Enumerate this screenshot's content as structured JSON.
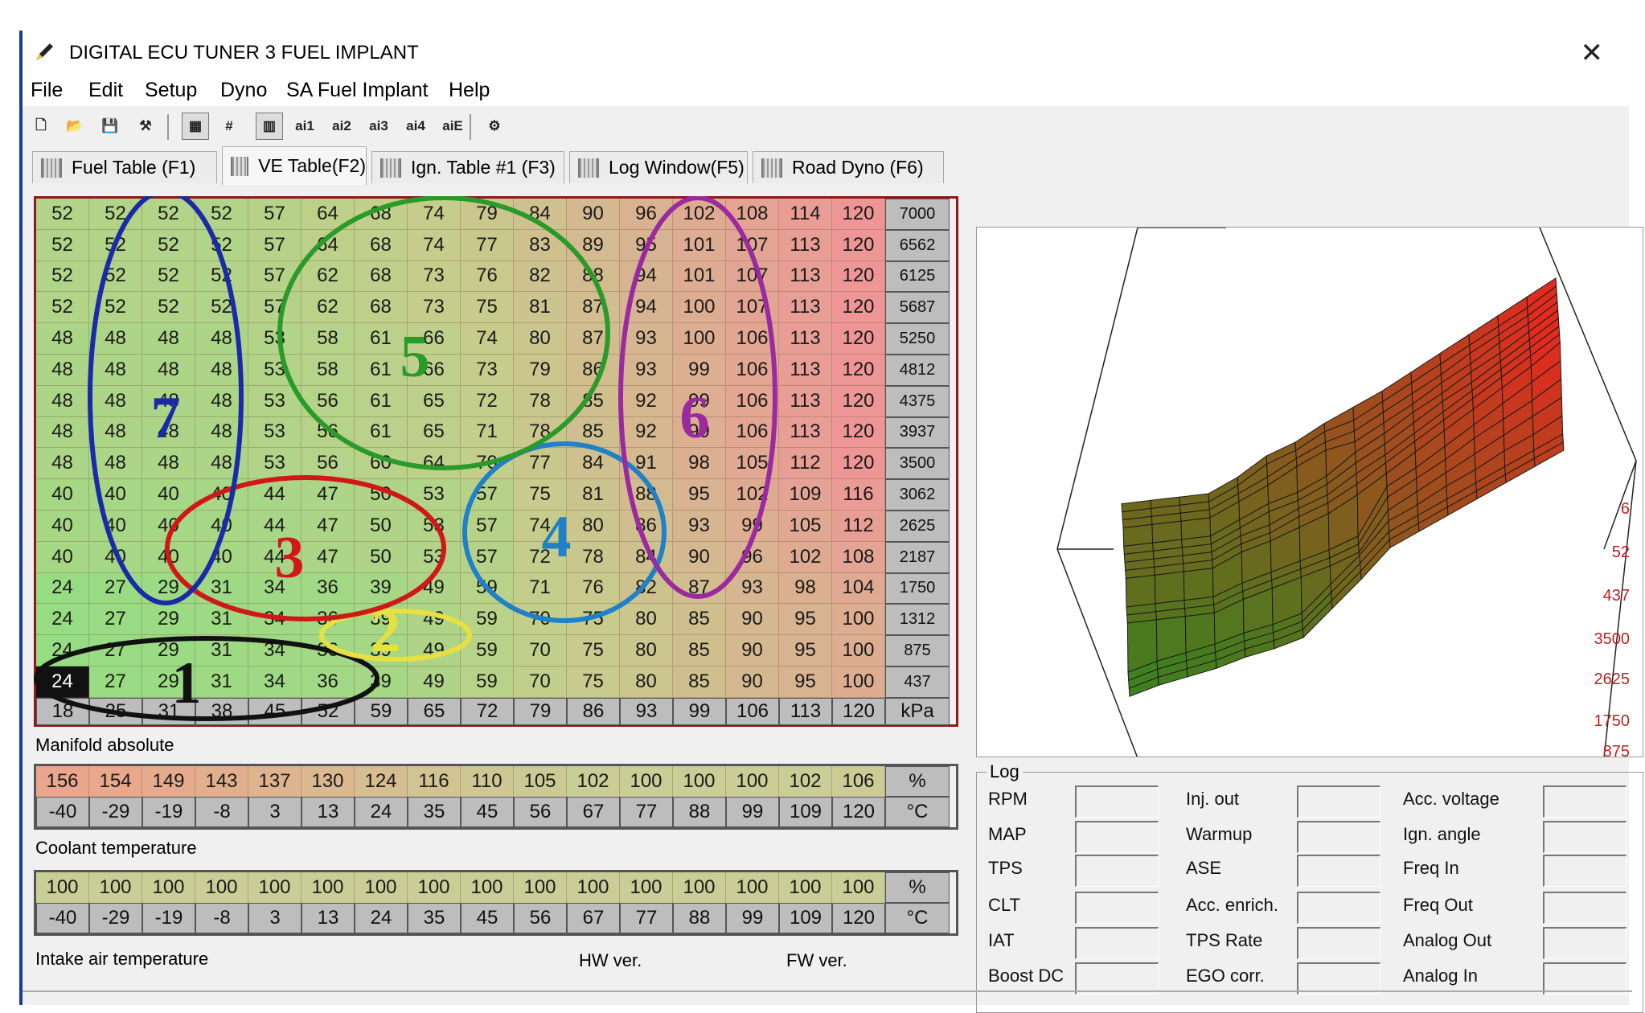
{
  "window": {
    "title": "DIGITAL ECU TUNER 3 FUEL IMPLANT",
    "close": "✕"
  },
  "menu": [
    "File",
    "Edit",
    "Setup",
    "Dyno",
    "SA Fuel Implant",
    "Help"
  ],
  "toolbar": [
    {
      "name": "new-file-icon",
      "glyph": "🗋"
    },
    {
      "name": "open-folder-icon",
      "glyph": "📂"
    },
    {
      "name": "save-icon",
      "glyph": "💾"
    },
    {
      "name": "tools-icon",
      "glyph": "⚒"
    },
    {
      "name": "grid-view-icon",
      "glyph": "▦",
      "selected": true
    },
    {
      "name": "grid-lines-icon",
      "glyph": "#"
    },
    {
      "name": "table-cursor-icon",
      "glyph": "▥",
      "selected": true
    },
    {
      "name": "ai1-icon",
      "glyph": "ai1"
    },
    {
      "name": "ai2-icon",
      "glyph": "ai2"
    },
    {
      "name": "ai3-icon",
      "glyph": "ai3"
    },
    {
      "name": "ai4-icon",
      "glyph": "ai4"
    },
    {
      "name": "aiE-icon",
      "glyph": "aiE"
    },
    {
      "name": "settings-gear-icon",
      "glyph": "⚙"
    }
  ],
  "tabs": [
    {
      "label": "Fuel Table (F1)",
      "active": false
    },
    {
      "label": "VE Table(F2)",
      "active": true
    },
    {
      "label": "Ign. Table #1 (F3)",
      "active": false
    },
    {
      "label": "Log Window(F5)",
      "active": false
    },
    {
      "label": "Road Dyno (F6)",
      "active": false
    }
  ],
  "ve_table": {
    "rpm": [
      "7000",
      "6562",
      "6125",
      "5687",
      "5250",
      "4812",
      "4375",
      "3937",
      "3500",
      "3062",
      "2625",
      "2187",
      "1750",
      "1312",
      "875",
      "437"
    ],
    "kpa": [
      "18",
      "25",
      "31",
      "38",
      "45",
      "52",
      "59",
      "65",
      "72",
      "79",
      "86",
      "93",
      "99",
      "106",
      "113",
      "120"
    ],
    "kpa_unit": "kPa",
    "rows": [
      [
        "52",
        "52",
        "52",
        "52",
        "57",
        "64",
        "68",
        "74",
        "79",
        "84",
        "90",
        "96",
        "102",
        "108",
        "114",
        "120"
      ],
      [
        "52",
        "52",
        "52",
        "52",
        "57",
        "64",
        "68",
        "74",
        "77",
        "83",
        "89",
        "95",
        "101",
        "107",
        "113",
        "120"
      ],
      [
        "52",
        "52",
        "52",
        "52",
        "57",
        "62",
        "68",
        "73",
        "76",
        "82",
        "88",
        "94",
        "101",
        "107",
        "113",
        "120"
      ],
      [
        "52",
        "52",
        "52",
        "52",
        "57",
        "62",
        "68",
        "73",
        "75",
        "81",
        "87",
        "94",
        "100",
        "107",
        "113",
        "120"
      ],
      [
        "48",
        "48",
        "48",
        "48",
        "53",
        "58",
        "61",
        "66",
        "74",
        "80",
        "87",
        "93",
        "100",
        "106",
        "113",
        "120"
      ],
      [
        "48",
        "48",
        "48",
        "48",
        "53",
        "58",
        "61",
        "66",
        "73",
        "79",
        "86",
        "93",
        "99",
        "106",
        "113",
        "120"
      ],
      [
        "48",
        "48",
        "48",
        "48",
        "53",
        "56",
        "61",
        "65",
        "72",
        "78",
        "85",
        "92",
        "99",
        "106",
        "113",
        "120"
      ],
      [
        "48",
        "48",
        "48",
        "48",
        "53",
        "56",
        "61",
        "65",
        "71",
        "78",
        "85",
        "92",
        "99",
        "106",
        "113",
        "120"
      ],
      [
        "48",
        "48",
        "48",
        "48",
        "53",
        "56",
        "60",
        "64",
        "70",
        "77",
        "84",
        "91",
        "98",
        "105",
        "112",
        "120"
      ],
      [
        "40",
        "40",
        "40",
        "40",
        "44",
        "47",
        "50",
        "53",
        "57",
        "75",
        "81",
        "88",
        "95",
        "102",
        "109",
        "116"
      ],
      [
        "40",
        "40",
        "40",
        "40",
        "44",
        "47",
        "50",
        "53",
        "57",
        "74",
        "80",
        "86",
        "93",
        "99",
        "105",
        "112"
      ],
      [
        "40",
        "40",
        "40",
        "40",
        "44",
        "47",
        "50",
        "53",
        "57",
        "72",
        "78",
        "84",
        "90",
        "96",
        "102",
        "108"
      ],
      [
        "24",
        "27",
        "29",
        "31",
        "34",
        "36",
        "39",
        "49",
        "59",
        "71",
        "76",
        "82",
        "87",
        "93",
        "98",
        "104"
      ],
      [
        "24",
        "27",
        "29",
        "31",
        "34",
        "36",
        "39",
        "49",
        "59",
        "70",
        "75",
        "80",
        "85",
        "90",
        "95",
        "100"
      ],
      [
        "24",
        "27",
        "29",
        "31",
        "34",
        "36",
        "39",
        "49",
        "59",
        "70",
        "75",
        "80",
        "85",
        "90",
        "95",
        "100"
      ],
      [
        "24",
        "27",
        "29",
        "31",
        "34",
        "36",
        "39",
        "49",
        "59",
        "70",
        "75",
        "80",
        "85",
        "90",
        "95",
        "100"
      ]
    ],
    "selected_cell": "24",
    "caption": "Manifold absolute"
  },
  "annotations": [
    {
      "label": "1",
      "color": "#111111"
    },
    {
      "label": "2",
      "color": "#e8e040"
    },
    {
      "label": "3",
      "color": "#d01818"
    },
    {
      "label": "4",
      "color": "#2080c8"
    },
    {
      "label": "5",
      "color": "#2a9a2a"
    },
    {
      "label": "6",
      "color": "#9a2aa0"
    },
    {
      "label": "7",
      "color": "#1a2aa8"
    }
  ],
  "coolant": {
    "values": [
      "156",
      "154",
      "149",
      "143",
      "137",
      "130",
      "124",
      "116",
      "110",
      "105",
      "102",
      "100",
      "100",
      "100",
      "102",
      "106"
    ],
    "temps": [
      "-40",
      "-29",
      "-19",
      "-8",
      "3",
      "13",
      "24",
      "35",
      "45",
      "56",
      "67",
      "77",
      "88",
      "99",
      "109",
      "120"
    ],
    "unit_pct": "%",
    "unit_temp": "°C",
    "caption": "Coolant temperature"
  },
  "intake_air": {
    "values": [
      "100",
      "100",
      "100",
      "100",
      "100",
      "100",
      "100",
      "100",
      "100",
      "100",
      "100",
      "100",
      "100",
      "100",
      "100",
      "100"
    ],
    "temps": [
      "-40",
      "-29",
      "-19",
      "-8",
      "3",
      "13",
      "24",
      "35",
      "45",
      "56",
      "67",
      "77",
      "88",
      "99",
      "109",
      "120"
    ],
    "unit_pct": "%",
    "unit_temp": "°C",
    "caption": "Intake air temperature"
  },
  "versions": {
    "hw": "HW ver.",
    "fw": "FW ver."
  },
  "plot3d": {
    "axis_labels": [
      "6",
      "52",
      "437",
      "3500",
      "2625",
      "1750",
      "875"
    ]
  },
  "log": {
    "title": "Log",
    "col1": [
      "RPM",
      "MAP",
      "TPS",
      "CLT",
      "IAT",
      "Boost DC"
    ],
    "col2": [
      "Inj. out",
      "Warmup",
      "ASE",
      "Acc. enrich.",
      "TPS Rate",
      "EGO corr."
    ],
    "col3": [
      "Acc. voltage",
      "Ign. angle",
      "Freq In",
      "Freq Out",
      "Analog Out",
      "Analog In"
    ]
  }
}
